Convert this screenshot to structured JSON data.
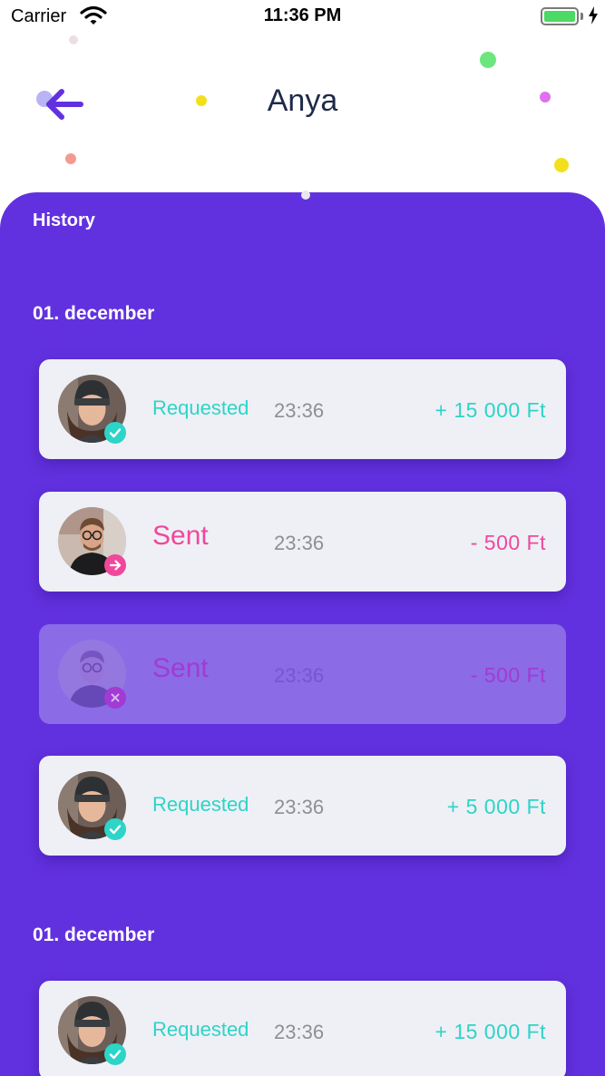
{
  "status_bar": {
    "carrier": "Carrier",
    "time": "11:36 PM",
    "wifi_icon": "wifi-icon",
    "battery_icon": "battery-icon",
    "charging_icon": "charging-bolt-icon"
  },
  "header": {
    "title": "Anya",
    "back_icon": "arrow-left-icon"
  },
  "history": {
    "label": "History"
  },
  "groups": [
    {
      "date": "01. december",
      "transactions": [
        {
          "status": "Requested",
          "time": "23:36",
          "amount": "+ 15 000 Ft",
          "avatar": "woman-beanie-avatar",
          "badge_icon": "check-icon"
        },
        {
          "status": "Sent",
          "time": "23:36",
          "amount": "- 500 Ft",
          "avatar": "man-glasses-avatar",
          "badge_icon": "arrow-right-icon"
        },
        {
          "status": "Sent",
          "time": "23:36",
          "amount": "- 500 Ft",
          "avatar": "man-glasses-avatar",
          "badge_icon": "cross-icon"
        },
        {
          "status": "Requested",
          "time": "23:36",
          "amount": "+ 5 000 Ft",
          "avatar": "woman-beanie-avatar",
          "badge_icon": "check-icon"
        }
      ]
    },
    {
      "date": "01. december",
      "transactions": [
        {
          "status": "Requested",
          "time": "23:36",
          "amount": "+ 15 000 Ft",
          "avatar": "woman-beanie-avatar",
          "badge_icon": "check-icon"
        }
      ]
    }
  ],
  "colors": {
    "panel": "#6231df",
    "requested": "#2dd4c8",
    "sent": "#f0479c",
    "title": "#1e2a4a",
    "card": "#eef0f5"
  }
}
